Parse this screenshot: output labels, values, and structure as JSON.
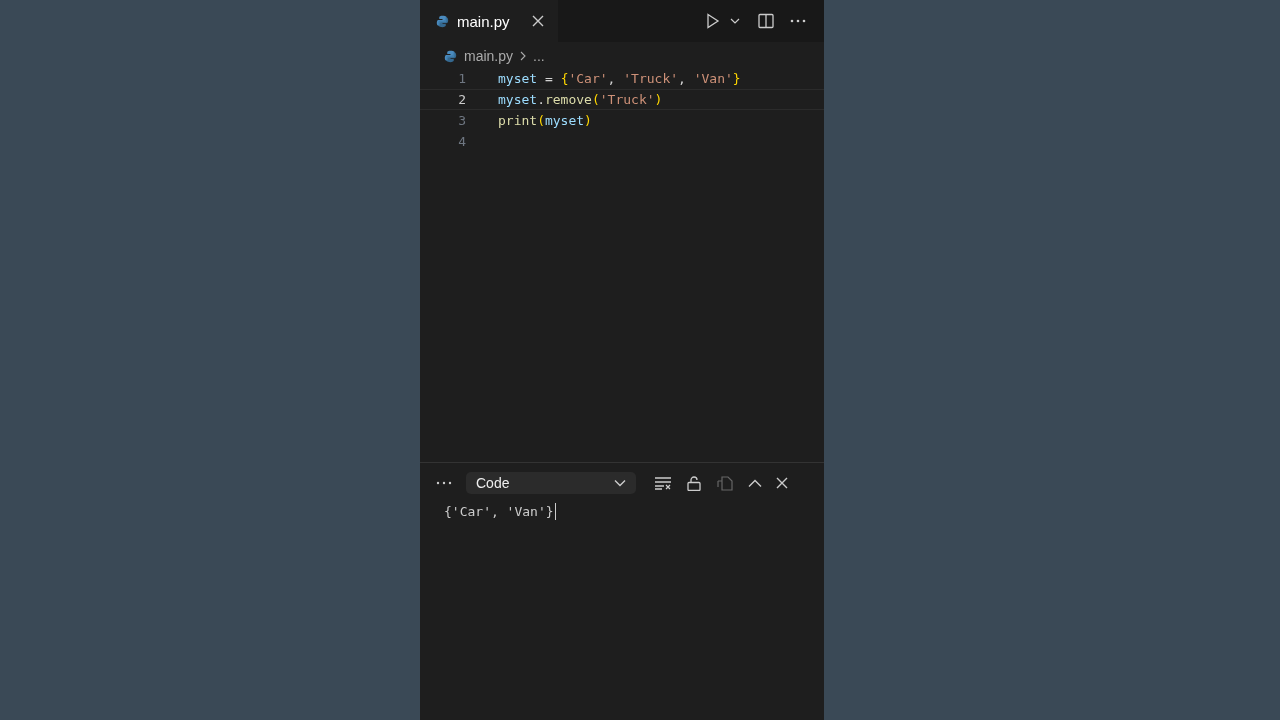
{
  "tab": {
    "label": "main.py",
    "selected": true
  },
  "breadcrumb": {
    "file": "main.py",
    "more": "..."
  },
  "code_lines": [
    {
      "number": "1",
      "selected": false,
      "tokens": [
        {
          "kind": "var",
          "text": "myset"
        },
        {
          "kind": "op",
          "text": " = "
        },
        {
          "kind": "brace",
          "text": "{"
        },
        {
          "kind": "str",
          "text": "'Car'"
        },
        {
          "kind": "op",
          "text": ", "
        },
        {
          "kind": "str",
          "text": "'Truck'"
        },
        {
          "kind": "op",
          "text": ", "
        },
        {
          "kind": "str",
          "text": "'Van'"
        },
        {
          "kind": "brace",
          "text": "}"
        }
      ]
    },
    {
      "number": "2",
      "selected": true,
      "tokens": [
        {
          "kind": "var",
          "text": "myset"
        },
        {
          "kind": "op",
          "text": "."
        },
        {
          "kind": "func",
          "text": "remove"
        },
        {
          "kind": "brace",
          "text": "("
        },
        {
          "kind": "str",
          "text": "'Truck'"
        },
        {
          "kind": "brace",
          "text": ")"
        }
      ]
    },
    {
      "number": "3",
      "selected": false,
      "tokens": [
        {
          "kind": "func",
          "text": "print"
        },
        {
          "kind": "brace",
          "text": "("
        },
        {
          "kind": "var",
          "text": "myset"
        },
        {
          "kind": "brace",
          "text": ")"
        }
      ]
    },
    {
      "number": "4",
      "selected": false
    }
  ],
  "output_panel": {
    "dropdown": "Code",
    "output": "{'Car', 'Van'}"
  }
}
